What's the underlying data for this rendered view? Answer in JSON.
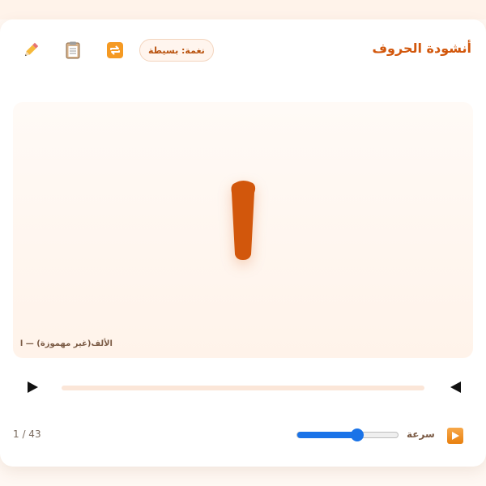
{
  "header": {
    "title": "أنشودة الحروف",
    "tune_label": "نغمة: بسيطة",
    "icons": [
      "pencil-icon",
      "clipboard-icon",
      "repeat-icon"
    ]
  },
  "stage": {
    "letter": "ا",
    "caption": "الألف(غير مهموزة) — ا"
  },
  "transport": {
    "progress": 0
  },
  "controls": {
    "speed_label": "سرعة",
    "speed_value": 0.6,
    "counter": "1 / 43"
  },
  "colors": {
    "accent": "#d2570c",
    "slider": "#1a73e8"
  }
}
